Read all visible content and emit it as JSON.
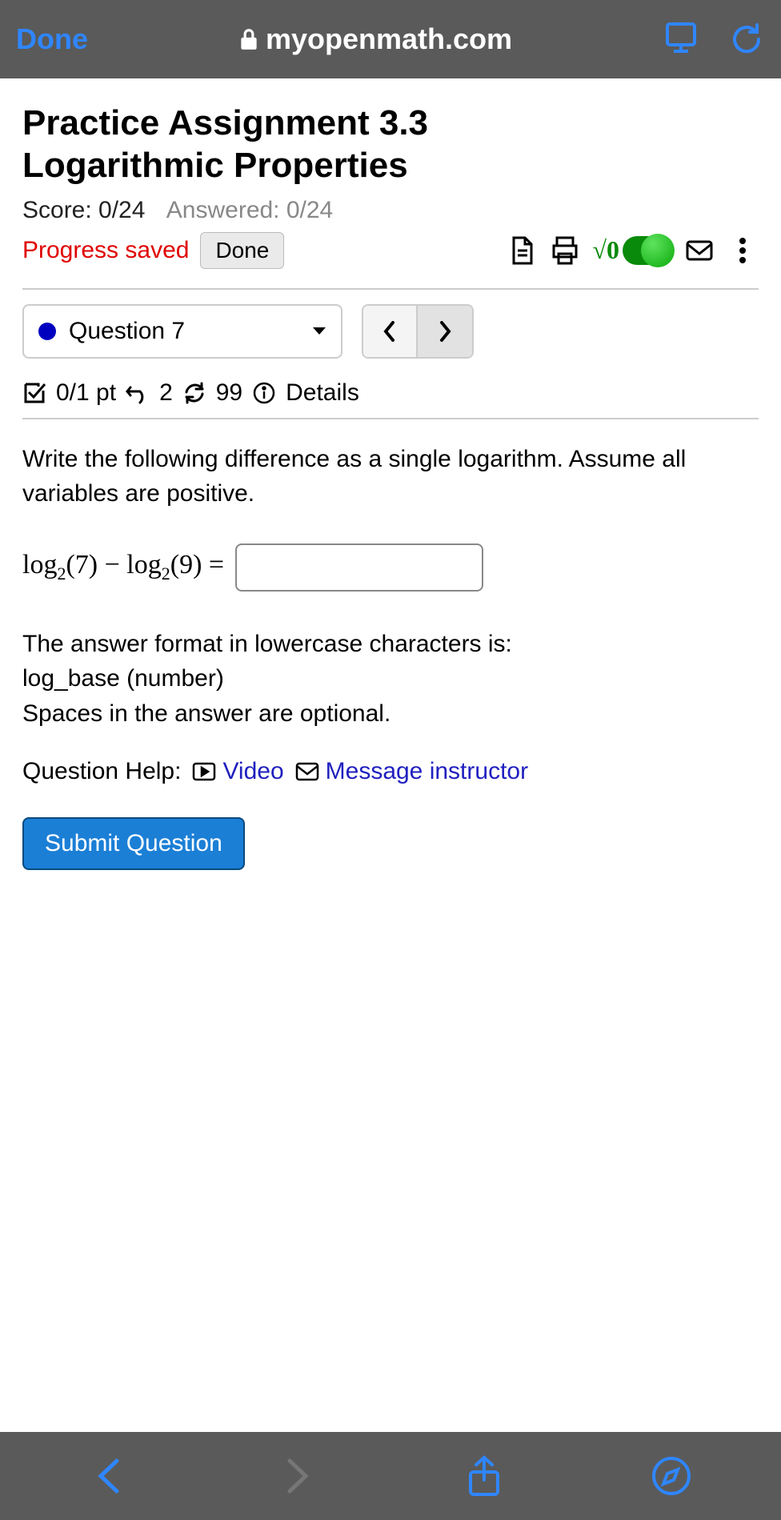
{
  "browser": {
    "done_label": "Done",
    "url": "myopenmath.com"
  },
  "page": {
    "title_line1": "Practice Assignment 3.3",
    "title_line2": "Logarithmic Properties",
    "score_label": "Score: 0/24",
    "answered_label": "Answered: 0/24",
    "progress_saved": "Progress saved",
    "done_button": "Done",
    "math_toggle_label": "√0"
  },
  "question_nav": {
    "current_label": "Question 7"
  },
  "meta": {
    "points": "0/1 pt",
    "retries": "2",
    "attempts": "99",
    "details_label": "Details"
  },
  "question": {
    "prompt": "Write the following difference as a single logarithm. Assume all variables are positive.",
    "expr_a_fn": "log",
    "expr_a_base": "2",
    "expr_a_arg": "(7)",
    "minus": " − ",
    "expr_b_fn": "log",
    "expr_b_base": "2",
    "expr_b_arg": "(9)",
    "equals": " = ",
    "answer_value": "",
    "format_line1": "The answer format in lowercase characters is:",
    "format_line2": "log_base (number)",
    "format_line3": "Spaces in the answer are optional."
  },
  "help": {
    "label": "Question Help:",
    "video_label": "Video",
    "message_label": "Message instructor"
  },
  "submit": {
    "label": "Submit Question"
  }
}
